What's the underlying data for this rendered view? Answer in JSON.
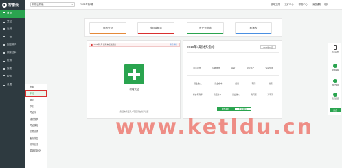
{
  "app": {
    "logo_text": "柠檬云"
  },
  "sidebar": {
    "items": [
      {
        "label": "首页",
        "icon": "home-icon",
        "active": true
      },
      {
        "label": "凭证",
        "icon": "voucher-icon"
      },
      {
        "label": "出纳",
        "icon": "cashier-icon"
      },
      {
        "label": "工资",
        "icon": "salary-icon"
      },
      {
        "label": "固定资产",
        "icon": "assets-icon"
      },
      {
        "label": "期末结转",
        "icon": "transfer-icon"
      },
      {
        "label": "账簿",
        "icon": "ledger-icon"
      },
      {
        "label": "报表",
        "icon": "report-icon"
      },
      {
        "label": "税务",
        "icon": "tax-icon"
      },
      {
        "label": "设置",
        "icon": "settings-icon"
      }
    ]
  },
  "submenu": {
    "items": [
      {
        "label": "账套"
      },
      {
        "label": "科目",
        "selected": true
      },
      {
        "label": "期初"
      },
      {
        "label": "币别"
      },
      {
        "label": "凭证字"
      },
      {
        "label": "辅助核算"
      },
      {
        "label": "凭证模板"
      },
      {
        "label": "权限设置"
      },
      {
        "label": "备份恢复"
      },
      {
        "label": "操作日志"
      },
      {
        "label": "重新初始化"
      }
    ]
  },
  "topbar": {
    "company": "柠檬云财税",
    "period": "2018年第1期",
    "links": [
      "使用工具",
      "文件中心",
      "帮助中心",
      "消息通知"
    ]
  },
  "quick": {
    "items": [
      {
        "label": "查看凭证",
        "color": "#e58a3a"
      },
      {
        "label": "科目余额表",
        "color": "#d9302f"
      },
      {
        "label": "资产负债表",
        "color": "#2aa44f"
      },
      {
        "label": "利润表",
        "color": "#4a90e2"
      }
    ]
  },
  "voucher": {
    "notice": "2018年1月 您有未结账凭证",
    "notice_link": "查看详情",
    "new_label": "新增凭证",
    "footer": "您还未凭证录入项目请在资产设置"
  },
  "finance": {
    "title": "2018年1期财务指标",
    "period": "2018年01月",
    "row1": [
      "货币资金",
      "应收账款",
      "存货",
      "固定资产",
      "短期借款"
    ],
    "row2": [
      "营业收入",
      "营业成本",
      "费用",
      "利润",
      "税额"
    ],
    "row3": [
      "综合毛利率",
      "营运资本",
      "营业收入",
      "利润额",
      "净利润"
    ],
    "tab_on": "财务指标",
    "tab_off": "经营指标"
  },
  "dock": {
    "items": [
      {
        "label": "手机APP",
        "icon": "phone-icon"
      },
      {
        "label": "在线客服",
        "icon": "chat-icon"
      },
      {
        "label": "用户交流",
        "icon": "users-icon"
      },
      {
        "label": "意见反馈",
        "icon": "feedback-icon"
      }
    ],
    "button": "续费"
  },
  "watermark": "www.ketldu.cn",
  "colors": {
    "sidebar_bg": "#2e3a40",
    "accent": "#2aa44f",
    "alert": "#d9302f"
  }
}
